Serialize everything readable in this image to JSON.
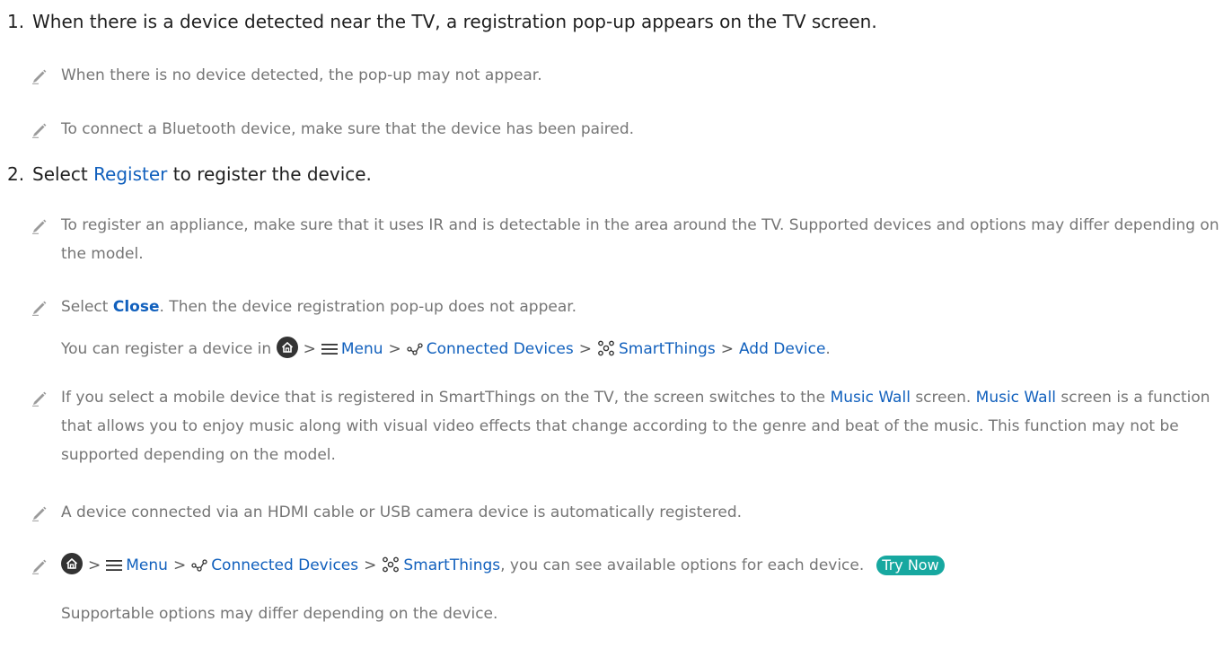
{
  "step1": {
    "number": "1.",
    "text": "When there is a device detected near the TV, a registration pop-up appears on the TV screen."
  },
  "note1": "When there is no device detected, the pop-up may not appear.",
  "note2": "To connect a Bluetooth device, make sure that the device has been paired.",
  "step2": {
    "number": "2.",
    "pre": "Select ",
    "link": "Register",
    "post": " to register the device."
  },
  "note3": "To register an appliance, make sure that it uses IR and is detectable in the area around the TV. Supported devices and options may differ depending on the model.",
  "note4": {
    "pre": "Select ",
    "link": "Close",
    "post": ". Then the device registration pop-up does not appear."
  },
  "path_line": {
    "pre": "You can register a device in ",
    "post": "."
  },
  "path": {
    "sep": ">",
    "menu": "Menu",
    "connected": "Connected Devices",
    "smartthings": "SmartThings",
    "add_device": "Add Device"
  },
  "note5": {
    "pre": "If you select a mobile device that is registered in SmartThings on the TV, the screen switches to the ",
    "link1": "Music Wall",
    "mid": " screen. ",
    "link2": "Music Wall",
    "post": " screen is a function that allows you to enjoy music along with visual video effects that change according to the genre and beat of the music. This function may not be supported depending on the model."
  },
  "note6": "A device connected via an HDMI cable or USB camera device is automatically registered.",
  "note7": {
    "post": ", you can see available options for each device.",
    "try_now": "Try Now"
  },
  "note7_sub": "Supportable options may differ depending on the device.",
  "colors": {
    "link": "#1160bd",
    "body": "#757575",
    "heading": "#1f1f1f",
    "try_now_bg": "#17a8a0"
  }
}
